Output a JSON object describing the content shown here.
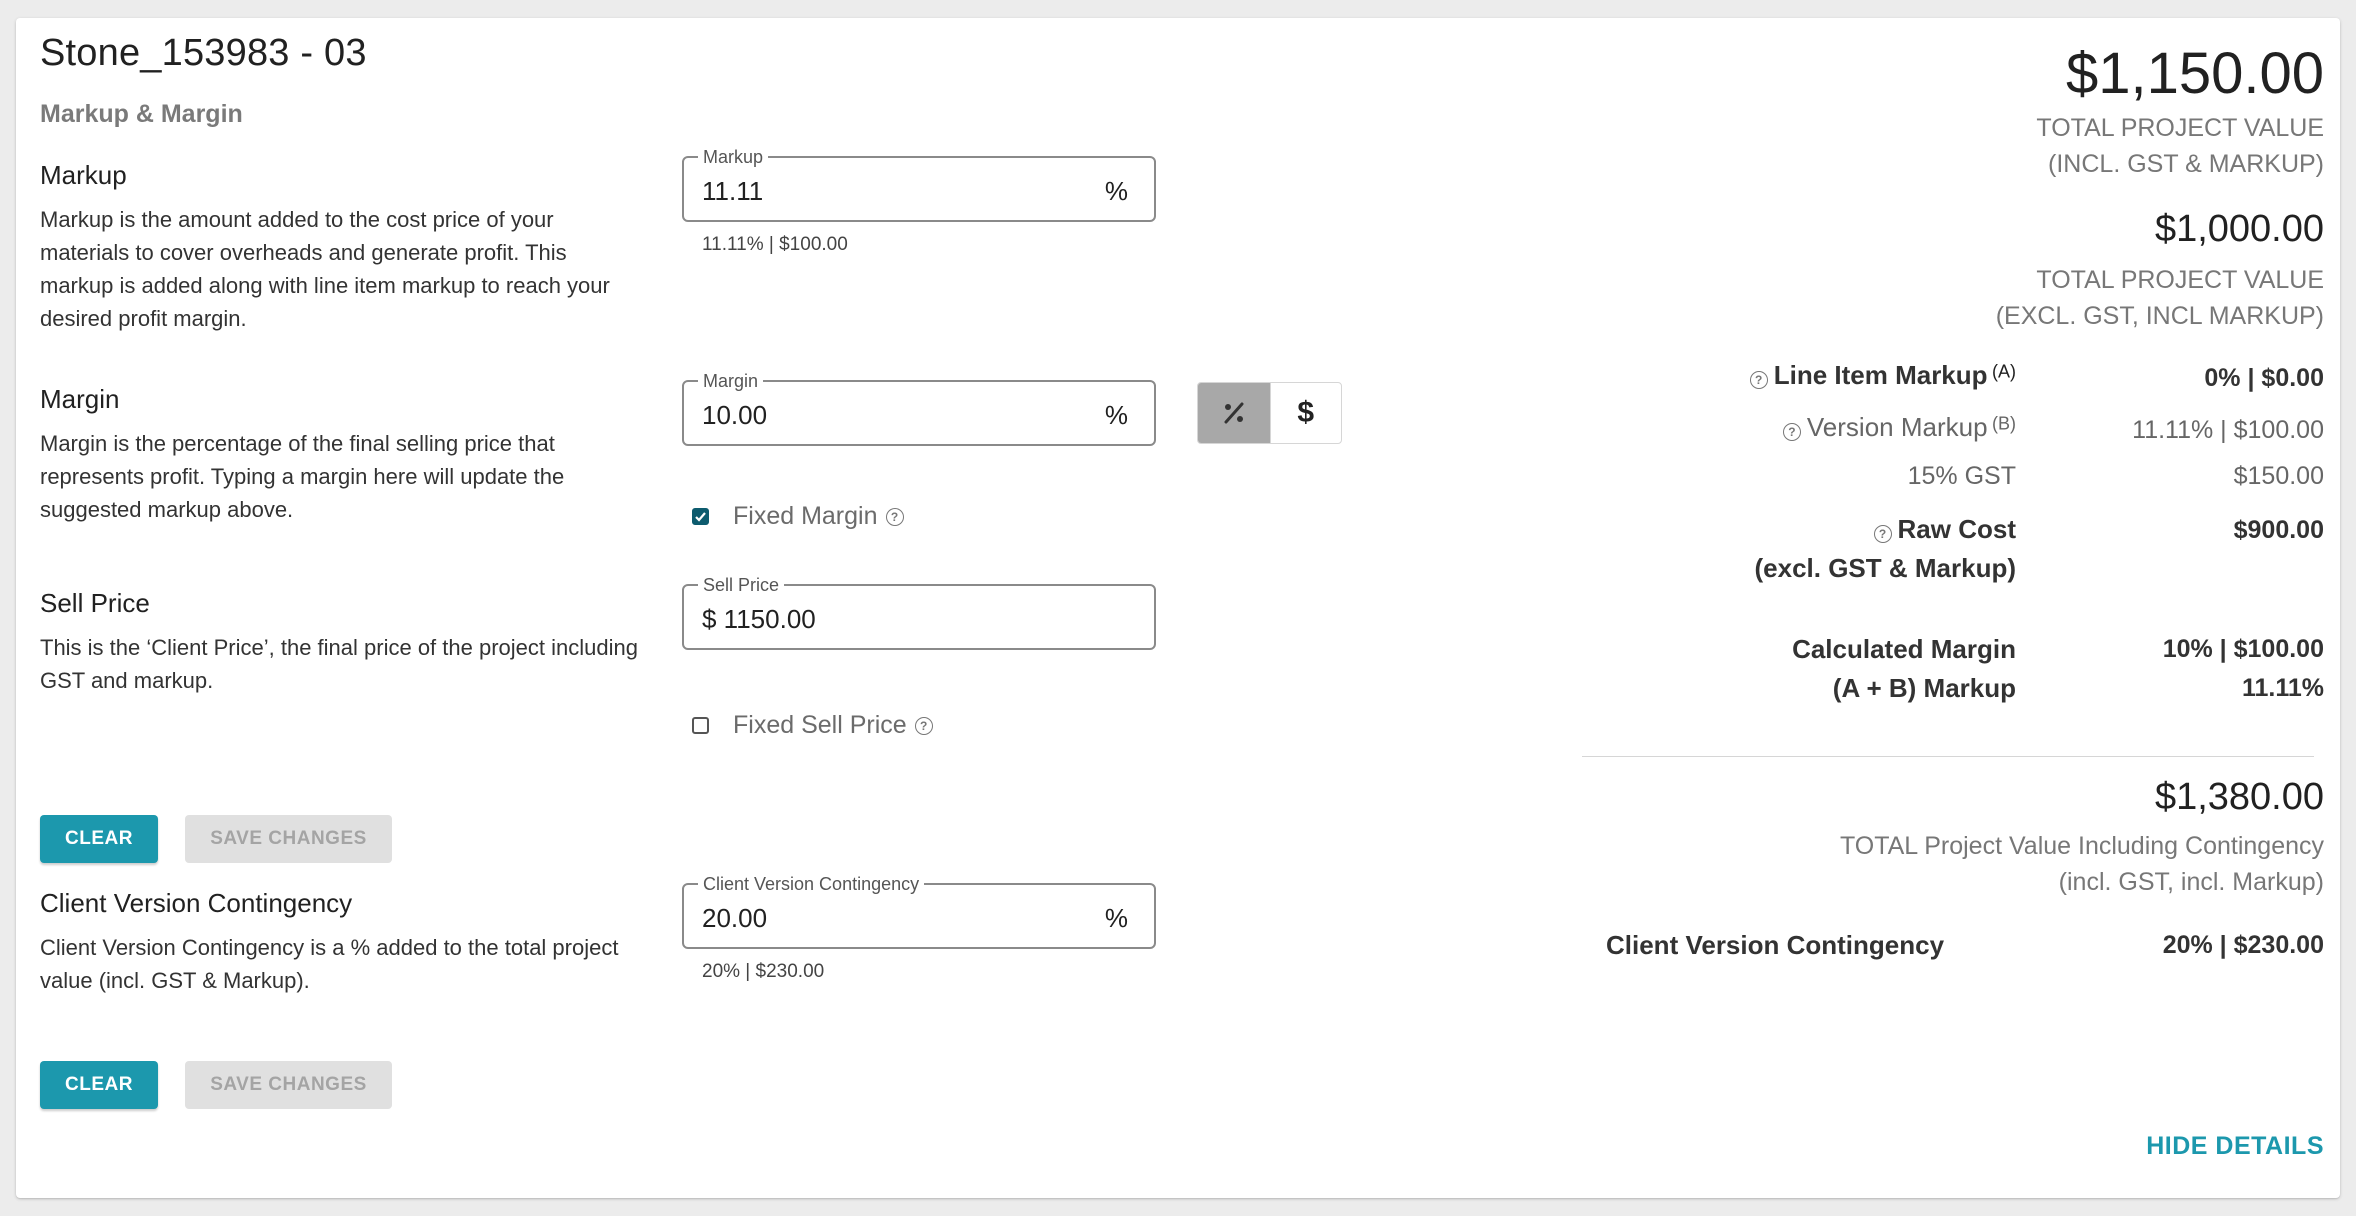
{
  "header": {
    "title": "Stone_153983 - 03",
    "subtitle": "Markup & Margin"
  },
  "sections": {
    "markup": {
      "heading": "Markup",
      "description": "Markup is the amount added to the cost price of your materials to cover overheads and generate profit. This markup is added along with line item markup to reach your desired profit margin.",
      "field_label": "Markup",
      "field_value": "11.11",
      "unit": "%",
      "helper": "11.11% | $100.00"
    },
    "margin": {
      "heading": "Margin",
      "description": "Margin is the percentage of the final selling price that represents profit. Typing a margin here will update the suggested markup above.",
      "field_label": "Margin",
      "field_value": "10.00",
      "unit": "%",
      "toggle_percent": "%",
      "toggle_dollar": "$",
      "fixed_label": "Fixed Margin",
      "fixed_checked": true
    },
    "sell_price": {
      "heading": "Sell Price",
      "description": "This is the ‘Client Price’, the final price of the project including GST and markup.",
      "field_label": "Sell Price",
      "field_value": "$ 1150.00",
      "fixed_label": "Fixed Sell Price",
      "fixed_checked": false
    },
    "contingency": {
      "heading": "Client Version Contingency",
      "description": "Client Version Contingency is a % added to the total project value (incl. GST & Markup).",
      "field_label": "Client Version Contingency",
      "field_value": "20.00",
      "unit": "%",
      "helper": "20% | $230.00"
    }
  },
  "buttons": {
    "clear": "CLEAR",
    "save": "SAVE CHANGES",
    "hide_details": "HIDE DETAILS"
  },
  "summary": {
    "total_value": "$1,150.00",
    "total_value_caption_1": "TOTAL PROJECT VALUE",
    "total_value_caption_2": "(INCL. GST & MARKUP)",
    "excl_value": "$1,000.00",
    "excl_caption_1": "TOTAL PROJECT VALUE",
    "excl_caption_2": "(EXCL. GST, INCL MARKUP)",
    "rows": {
      "line_item_label": "Line Item Markup",
      "line_item_sup": "(A)",
      "line_item_value": "0% | $0.00",
      "version_label": "Version Markup",
      "version_sup": "(B)",
      "version_value": "11.11% | $100.00",
      "gst_label": "15% GST",
      "gst_value": "$150.00",
      "raw_cost_label_1": "Raw Cost",
      "raw_cost_label_2": "(excl. GST & Markup)",
      "raw_cost_value": "$900.00",
      "calc_margin_label": "Calculated Margin",
      "calc_margin_value": "10% | $100.00",
      "ab_markup_label": "(A + B) Markup",
      "ab_markup_value": "11.11%"
    },
    "contingency_total": "$1,380.00",
    "contingency_caption_1": "TOTAL Project Value Including Contingency",
    "contingency_caption_2": "(incl. GST, incl. Markup)",
    "contingency_label": "Client Version Contingency",
    "contingency_value": "20% | $230.00"
  },
  "colors": {
    "accent": "#1c98ad",
    "checkbox": "#0d5b6e",
    "toggle_active": "#a8a8a8"
  }
}
